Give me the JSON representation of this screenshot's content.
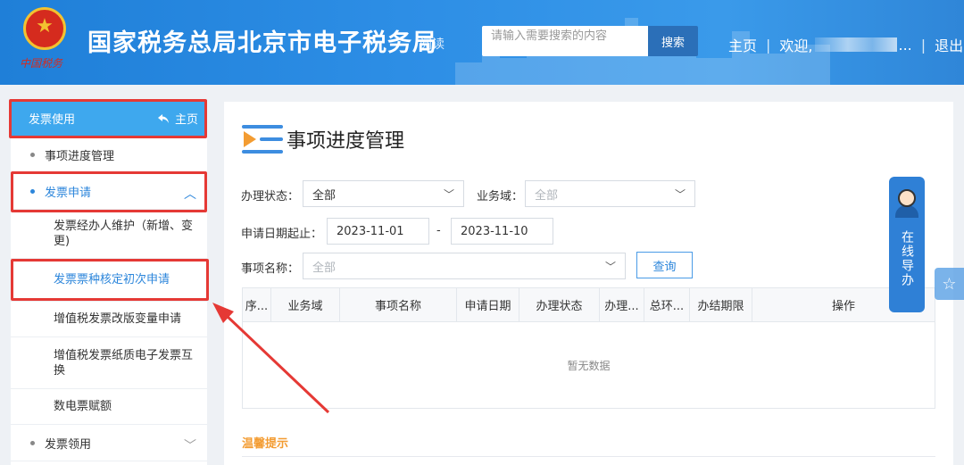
{
  "header": {
    "site_title": "国家税务总局北京市电子税务局",
    "accessible_read": "阅读",
    "emblem_script": "中国税务",
    "search_placeholder": "请输入需要搜索的内容",
    "search_button": "搜索",
    "home": "主页",
    "separator": "|",
    "welcome": "欢迎,",
    "ellipsis": "...",
    "logout": "退出"
  },
  "sidebar": {
    "head_title": "发票使用",
    "home_link": "主页",
    "items": [
      {
        "label": "事项进度管理"
      },
      {
        "label": "发票申请",
        "chevron": "︿"
      },
      {
        "label": "发票经办人维护（新增、变更)"
      },
      {
        "label": "发票票种核定初次申请"
      },
      {
        "label": "增值税发票改版变量申请"
      },
      {
        "label": "增值税发票纸质电子发票互换"
      },
      {
        "label": "数电票赋额"
      },
      {
        "label": "发票领用",
        "chevron": "﹀"
      }
    ]
  },
  "main": {
    "page_title": "事项进度管理",
    "status_label": "办理状态：",
    "status_value": "全部",
    "domain_label": "业务域：",
    "domain_placeholder": "全部",
    "date_label": "申请日期起止：",
    "date_start": "2023-11-01",
    "date_dash": "-",
    "date_end": "2023-11-10",
    "item_label": "事项名称：",
    "item_placeholder": "全部",
    "query_button": "查询",
    "table_headers": [
      "序...",
      "业务域",
      "事项名称",
      "申请日期",
      "办理状态",
      "办理...",
      "总环...",
      "办结期限",
      "操作"
    ],
    "empty_text": "暂无数据",
    "tip_title": "温馨提示"
  },
  "help": {
    "text": "在线导办"
  },
  "colors": {
    "header_blue": "#2e8fe6",
    "accent": "#2c86db",
    "annotation_red": "#e53935",
    "tip_orange": "#f39c32"
  }
}
